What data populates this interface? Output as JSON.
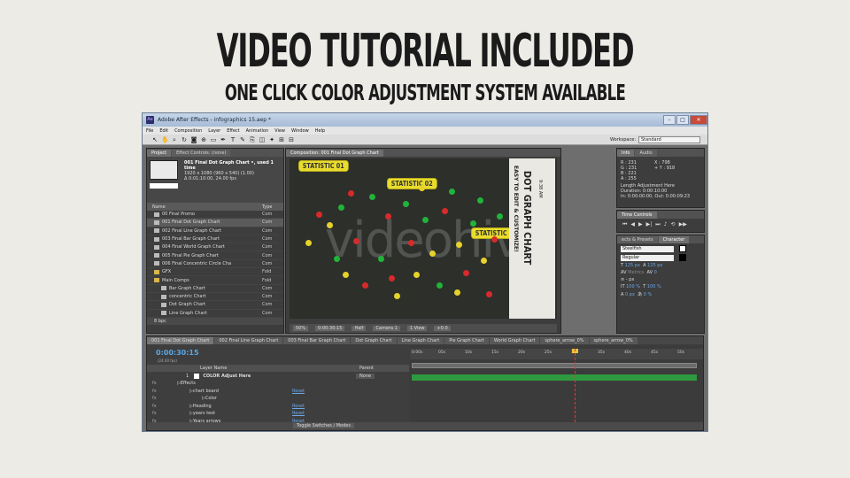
{
  "heading": "VIDEO TUTORIAL INCLUDED",
  "subheading": "ONE CLICK COLOR ADJUSTMENT SYSTEM AVAILABLE",
  "window": {
    "title": "Adobe After Effects - infographics 15.aep *",
    "menu": [
      "File",
      "Edit",
      "Composition",
      "Layer",
      "Effect",
      "Animation",
      "View",
      "Window",
      "Help"
    ],
    "workspace_label": "Workspace:",
    "workspace_value": "Standard"
  },
  "project_panel": {
    "tabs": [
      "Project",
      "Effect Controls: (none)"
    ],
    "selected_name": "001 Final Dot Graph Chart •, used 1 time",
    "selected_size": "1920 x 1080 (960 x 540) (1.00)",
    "selected_duration": "Δ 0:01:10:00, 24.00 fps",
    "col_name": "Name",
    "col_type": "Type",
    "items": [
      {
        "name": "00 Final Promo",
        "type": "Com",
        "icon": "comp",
        "indent": 0
      },
      {
        "name": "001 Final Dot Graph Chart",
        "type": "Com",
        "icon": "comp",
        "indent": 0,
        "selected": true
      },
      {
        "name": "002 Final Line Graph Chart",
        "type": "Com",
        "icon": "comp",
        "indent": 0
      },
      {
        "name": "003 Final Bar Graph Chart",
        "type": "Com",
        "icon": "comp",
        "indent": 0
      },
      {
        "name": "004 Final World Graph Chart",
        "type": "Com",
        "icon": "comp",
        "indent": 0
      },
      {
        "name": "005 Final Pie Graph Chart",
        "type": "Com",
        "icon": "comp",
        "indent": 0
      },
      {
        "name": "006 Final Concentric Circle Cha",
        "type": "Com",
        "icon": "comp",
        "indent": 0
      },
      {
        "name": "GFX",
        "type": "Fold",
        "icon": "folder",
        "indent": 0
      },
      {
        "name": "Main Comps",
        "type": "Fold",
        "icon": "folder",
        "indent": 0
      },
      {
        "name": "Bar Graph Chart",
        "type": "Com",
        "icon": "comp",
        "indent": 1
      },
      {
        "name": "concentric Chart",
        "type": "Com",
        "icon": "comp",
        "indent": 1
      },
      {
        "name": "Dot Graph Chart",
        "type": "Com",
        "icon": "comp",
        "indent": 1
      },
      {
        "name": "Line Graph Chart",
        "type": "Com",
        "icon": "comp",
        "indent": 1
      }
    ],
    "bpc": "8 bpc"
  },
  "composition": {
    "tab": "Composition: 001 Final Dot Graph Chart",
    "watermark": "videohive",
    "bubbles": [
      "STATISTIC 01",
      "STATISTIC 02",
      "STATISTIC 03"
    ],
    "vertical_text_a": "EASY TO EDIT & CUSTOMIZE!",
    "vertical_text_b": "DOT GRAPH CHART",
    "vertical_text_c": "9:38 AM",
    "footer": [
      "50%",
      "0:00:30:15",
      "Half",
      "Camera 1",
      "1 View",
      "+0.0"
    ]
  },
  "info_panel": {
    "tabs": [
      "Info",
      "Audio"
    ],
    "r": "R : 231",
    "g": "G : 231",
    "b": "B : 221",
    "a": "A : 255",
    "x": "X : 798",
    "y": "+ Y : 918",
    "line1": "Length Adjustment Here",
    "line2": "Duration: 0:00:10:00",
    "line3": "In: 0:00:00:00, Out: 0:00:09:23"
  },
  "time_controls": {
    "tab": "Time Controls"
  },
  "character_panel": {
    "tabs": [
      "ects & Presets",
      "Character"
    ],
    "font": "Steelfish",
    "style": "Regular",
    "size": "125 px",
    "leading": "125 px",
    "tracking_label": "Metrics",
    "tracking": "0",
    "unit": "- px",
    "vscale": "100 %",
    "hscale": "100 %",
    "baseline": "0 px",
    "tsume": "0 %"
  },
  "timeline": {
    "tabs": [
      "001 Final Dot Graph Chart",
      "002 Final Line Graph Chart",
      "003 Final Bar Graph Chart",
      "Dot Graph Chart",
      "Line Graph Chart",
      "Pie Graph Chart",
      "World Graph Chart",
      "sphere_arrow_0%",
      "sphere_arrow_0%"
    ],
    "timecode": "0:00:30:15",
    "fps": "(24.00 fps)",
    "col_layer_name": "Layer Name",
    "col_parent": "Parent",
    "parent_value": "None",
    "layer_number": "1",
    "layer_name": "COLOR Adjust Here",
    "rows": [
      {
        "label": "Effects",
        "indent": 2,
        "reset": ""
      },
      {
        "label": "chart board",
        "indent": 3,
        "reset": "Reset"
      },
      {
        "label": "Color",
        "indent": 4,
        "reset": ""
      },
      {
        "label": "Heading",
        "indent": 3,
        "reset": "Reset"
      },
      {
        "label": "years text",
        "indent": 3,
        "reset": "Reset"
      },
      {
        "label": "Years arrows",
        "indent": 3,
        "reset": "Reset"
      }
    ],
    "ruler": [
      "0:00s",
      "05s",
      "10s",
      "15s",
      "20s",
      "25s",
      "30s",
      "35s",
      "40s",
      "45s",
      "50s"
    ],
    "toggle": "Toggle Switches / Modes",
    "colors": {
      "layer_bar": "#2e9a3f",
      "cti": "#e33333",
      "timecode": "#59a6e6"
    }
  },
  "colors": {
    "dot_green": "#21b33a",
    "dot_yellow": "#e6d22a",
    "dot_red": "#d82a2a",
    "bubble": "#e9dc2c"
  }
}
